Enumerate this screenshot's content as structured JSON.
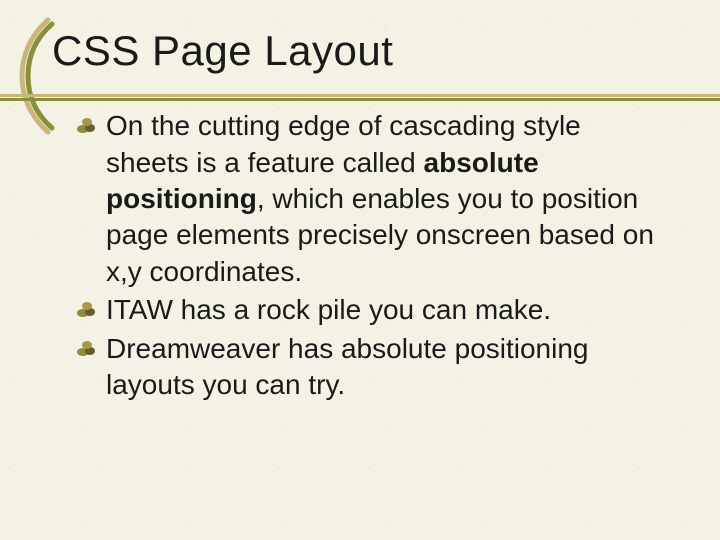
{
  "title": "CSS Page Layout",
  "colors": {
    "background": "#f4f2e4",
    "rule_tan": "#c9b77a",
    "rule_olive": "#8a8f3a",
    "bullet_olive": "#8a8f3a",
    "bullet_brown": "#6b5a2e",
    "text": "#1a1a1a"
  },
  "bullets": {
    "b0": {
      "pre": "On the cutting edge of cascading style sheets is a feature called ",
      "bold": "absolute positioning",
      "post": ", which enables you to position page elements precisely onscreen based on x,y coordinates."
    },
    "b1": {
      "text": "ITAW has a rock pile you can make."
    },
    "b2": {
      "text": "Dreamweaver has absolute positioning layouts you can try."
    }
  }
}
